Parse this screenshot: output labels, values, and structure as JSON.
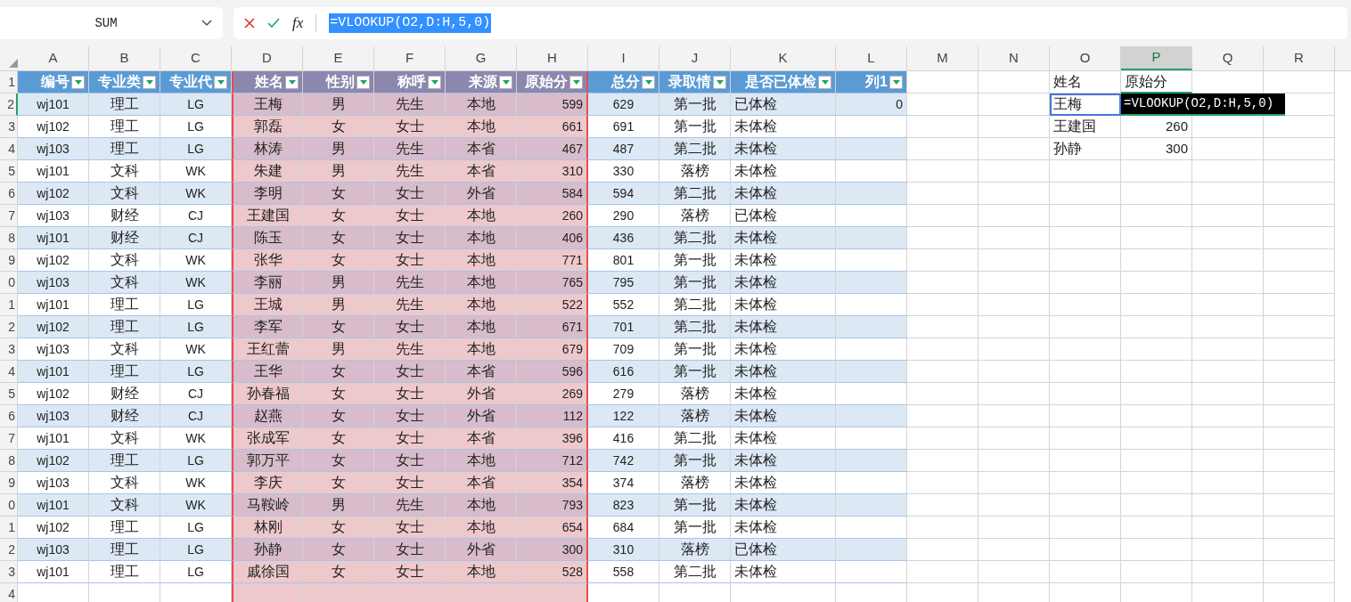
{
  "name_box": {
    "value": "SUM"
  },
  "formula_bar": {
    "function_label": "fx",
    "value": "=VLOOKUP(O2,D:H,5,0)"
  },
  "columns": [
    {
      "label": "A",
      "selected": false
    },
    {
      "label": "B",
      "selected": false
    },
    {
      "label": "C",
      "selected": false
    },
    {
      "label": "D",
      "selected": false
    },
    {
      "label": "E",
      "selected": false
    },
    {
      "label": "F",
      "selected": false
    },
    {
      "label": "G",
      "selected": false
    },
    {
      "label": "H",
      "selected": false
    },
    {
      "label": "I",
      "selected": false
    },
    {
      "label": "J",
      "selected": false
    },
    {
      "label": "K",
      "selected": false
    },
    {
      "label": "L",
      "selected": false
    },
    {
      "label": "M",
      "selected": false
    },
    {
      "label": "N",
      "selected": false
    },
    {
      "label": "O",
      "selected": false
    },
    {
      "label": "P",
      "selected": true
    },
    {
      "label": "Q",
      "selected": false
    },
    {
      "label": "R",
      "selected": false
    }
  ],
  "row_headers": [
    "1",
    "2",
    "3",
    "4",
    "5",
    "6",
    "7",
    "8",
    "9",
    "0",
    "1",
    "2",
    "3",
    "4",
    "5",
    "6",
    "7",
    "8",
    "9",
    "0",
    "1",
    "2",
    "3",
    "4"
  ],
  "table": {
    "headers": [
      "编号",
      "专业类",
      "专业代",
      "姓名",
      "性别",
      "称呼",
      "来源",
      "原始分",
      "总分",
      "录取情",
      "是否已体检",
      "列1"
    ],
    "rows": [
      [
        "wj101",
        "理工",
        "LG",
        "王梅",
        "男",
        "先生",
        "本地",
        "599",
        "629",
        "第一批",
        "已体检",
        "0"
      ],
      [
        "wj102",
        "理工",
        "LG",
        "郭磊",
        "女",
        "女士",
        "本地",
        "661",
        "691",
        "第一批",
        "未体检",
        ""
      ],
      [
        "wj103",
        "理工",
        "LG",
        "林涛",
        "男",
        "先生",
        "本省",
        "467",
        "487",
        "第二批",
        "未体检",
        ""
      ],
      [
        "wj101",
        "文科",
        "WK",
        "朱建",
        "男",
        "先生",
        "本省",
        "310",
        "330",
        "落榜",
        "未体检",
        ""
      ],
      [
        "wj102",
        "文科",
        "WK",
        "李明",
        "女",
        "女士",
        "外省",
        "584",
        "594",
        "第二批",
        "未体检",
        ""
      ],
      [
        "wj103",
        "财经",
        "CJ",
        "王建国",
        "女",
        "女士",
        "本地",
        "260",
        "290",
        "落榜",
        "已体检",
        ""
      ],
      [
        "wj101",
        "财经",
        "CJ",
        "陈玉",
        "女",
        "女士",
        "本地",
        "406",
        "436",
        "第二批",
        "未体检",
        ""
      ],
      [
        "wj102",
        "文科",
        "WK",
        "张华",
        "女",
        "女士",
        "本地",
        "771",
        "801",
        "第一批",
        "未体检",
        ""
      ],
      [
        "wj103",
        "文科",
        "WK",
        "李丽",
        "男",
        "先生",
        "本地",
        "765",
        "795",
        "第一批",
        "未体检",
        ""
      ],
      [
        "wj101",
        "理工",
        "LG",
        "王城",
        "男",
        "先生",
        "本地",
        "522",
        "552",
        "第二批",
        "未体检",
        ""
      ],
      [
        "wj102",
        "理工",
        "LG",
        "李军",
        "女",
        "女士",
        "本地",
        "671",
        "701",
        "第二批",
        "未体检",
        ""
      ],
      [
        "wj103",
        "文科",
        "WK",
        "王红蕾",
        "男",
        "先生",
        "本地",
        "679",
        "709",
        "第一批",
        "未体检",
        ""
      ],
      [
        "wj101",
        "理工",
        "LG",
        "王华",
        "女",
        "女士",
        "本省",
        "596",
        "616",
        "第一批",
        "未体检",
        ""
      ],
      [
        "wj102",
        "财经",
        "CJ",
        "孙春福",
        "女",
        "女士",
        "外省",
        "269",
        "279",
        "落榜",
        "未体检",
        ""
      ],
      [
        "wj103",
        "财经",
        "CJ",
        "赵燕",
        "女",
        "女士",
        "外省",
        "112",
        "122",
        "落榜",
        "未体检",
        ""
      ],
      [
        "wj101",
        "文科",
        "WK",
        "张成军",
        "女",
        "女士",
        "本省",
        "396",
        "416",
        "第二批",
        "未体检",
        ""
      ],
      [
        "wj102",
        "理工",
        "LG",
        "郭万平",
        "女",
        "女士",
        "本地",
        "712",
        "742",
        "第一批",
        "未体检",
        ""
      ],
      [
        "wj103",
        "文科",
        "WK",
        "李庆",
        "女",
        "女士",
        "本省",
        "354",
        "374",
        "落榜",
        "未体检",
        ""
      ],
      [
        "wj101",
        "文科",
        "WK",
        "马鞍岭",
        "男",
        "先生",
        "本地",
        "793",
        "823",
        "第一批",
        "未体检",
        ""
      ],
      [
        "wj102",
        "理工",
        "LG",
        "林刚",
        "女",
        "女士",
        "本地",
        "654",
        "684",
        "第一批",
        "未体检",
        ""
      ],
      [
        "wj103",
        "理工",
        "LG",
        "孙静",
        "女",
        "女士",
        "外省",
        "300",
        "310",
        "落榜",
        "已体检",
        ""
      ],
      [
        "wj101",
        "理工",
        "LG",
        "戚徐国",
        "女",
        "女士",
        "本地",
        "528",
        "558",
        "第二批",
        "未体检",
        ""
      ]
    ]
  },
  "lookup": {
    "headers": [
      "姓名",
      "原始分"
    ],
    "rows": [
      {
        "name": "王梅",
        "selected": true,
        "kind": "formula",
        "value": "=VLOOKUP(O2,D:H,5,0)"
      },
      {
        "name": "王建国",
        "selected": false,
        "kind": "number",
        "value": "260"
      },
      {
        "name": "孙静",
        "selected": false,
        "kind": "number",
        "value": "300"
      }
    ]
  }
}
